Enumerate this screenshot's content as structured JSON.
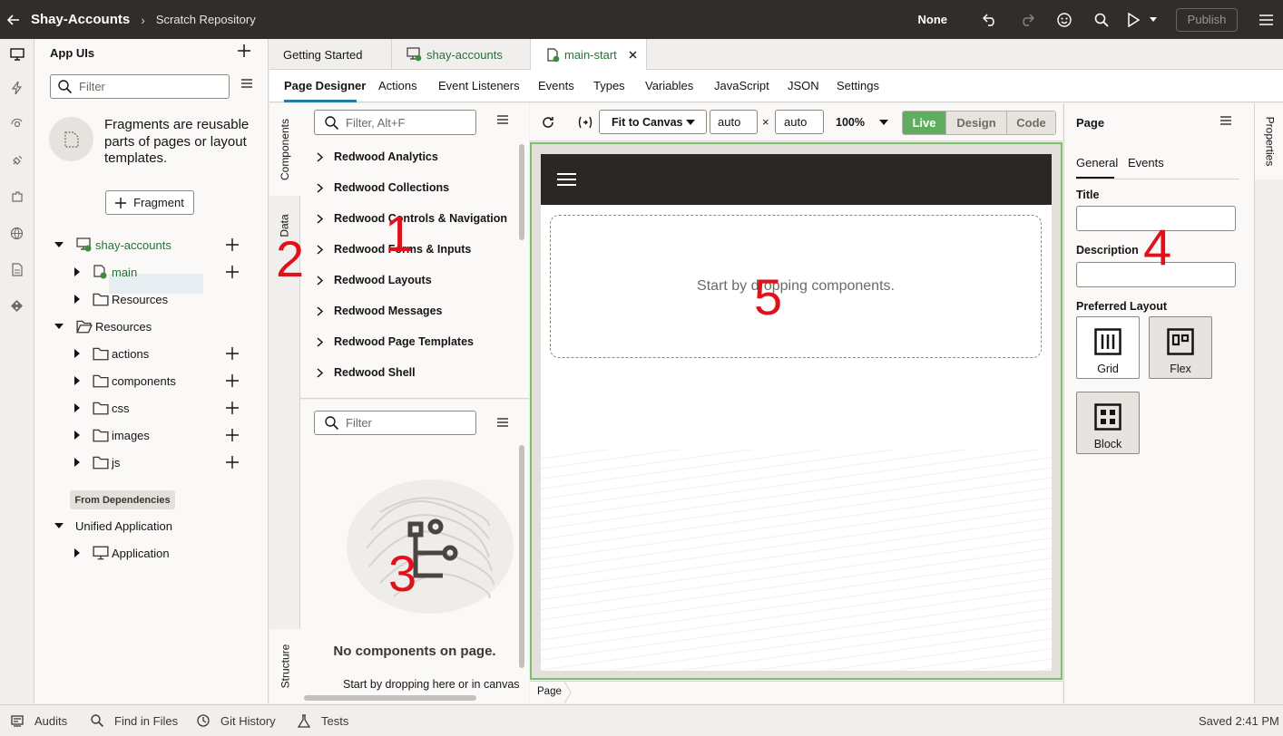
{
  "topbar": {
    "app_title": "Shay-Accounts",
    "breadcrumb": "Scratch Repository",
    "branch_selector": "None",
    "publish_label": "Publish"
  },
  "left_rail": {
    "icons": [
      "app-uis-icon",
      "flash-icon",
      "services-icon",
      "plugin-icon",
      "business-objects-icon",
      "web-apps-icon",
      "document-icon",
      "git-icon"
    ]
  },
  "left_panel": {
    "title": "App UIs",
    "filter_placeholder": "Filter",
    "fragment_info": "Fragments are reusable parts of pages or layout templates.",
    "fragment_button": "Fragment",
    "tree": [
      {
        "label": "shay-accounts"
      },
      {
        "label": "main"
      },
      {
        "label": "Resources"
      },
      {
        "label": "Resources"
      },
      {
        "label": "actions"
      },
      {
        "label": "components"
      },
      {
        "label": "css"
      },
      {
        "label": "images"
      },
      {
        "label": "js"
      }
    ],
    "dependencies_label": "From Dependencies",
    "dep_tree": [
      {
        "label": "Unified Application"
      },
      {
        "label": "Application"
      }
    ]
  },
  "doc_tabs": [
    {
      "label": "Getting Started"
    },
    {
      "label": "shay-accounts"
    },
    {
      "label": "main-start"
    }
  ],
  "sub_tabs": [
    "Page Designer",
    "Actions",
    "Event Listeners",
    "Events",
    "Types",
    "Variables",
    "JavaScript",
    "JSON",
    "Settings"
  ],
  "vertical_tabs": {
    "components": "Components",
    "data": "Data",
    "structure": "Structure"
  },
  "components_panel": {
    "filter_placeholder": "Filter, Alt+F",
    "categories": [
      "Redwood Analytics",
      "Redwood Collections",
      "Redwood Controls & Navigation",
      "Redwood Forms & Inputs",
      "Redwood Layouts",
      "Redwood Messages",
      "Redwood Page Templates",
      "Redwood Shell"
    ]
  },
  "structure_panel": {
    "filter_placeholder": "Filter",
    "empty_title": "No components on page.",
    "empty_text": "Start by dropping here or in canvas"
  },
  "canvas_toolbar": {
    "fit_label": "Fit to Canvas",
    "width_value": "auto",
    "times": "×",
    "height_value": "auto",
    "zoom": "100%",
    "modes": [
      "Live",
      "Design",
      "Code"
    ]
  },
  "canvas": {
    "drop_hint": "Start by dropping components.",
    "footer_crumb": "Page"
  },
  "properties": {
    "title": "Page",
    "tabs": [
      "General",
      "Events"
    ],
    "title_label": "Title",
    "title_value": "",
    "description_label": "Description",
    "description_value": "",
    "layout_label": "Preferred Layout",
    "layouts": [
      "Grid",
      "Flex",
      "Block"
    ],
    "side_tab": "Properties"
  },
  "statusbar": {
    "items": [
      "Audits",
      "Find in Files",
      "Git History",
      "Tests"
    ],
    "saved": "Saved 2:41 PM"
  },
  "annotations": [
    "1",
    "2",
    "3",
    "4",
    "5"
  ],
  "colors": {
    "topbar": "#312d2a",
    "accent_green": "#5fae5f",
    "canvas_border": "#7bbf6a",
    "annotation_red": "#e0111b",
    "tab_underline": "#227e9e"
  }
}
